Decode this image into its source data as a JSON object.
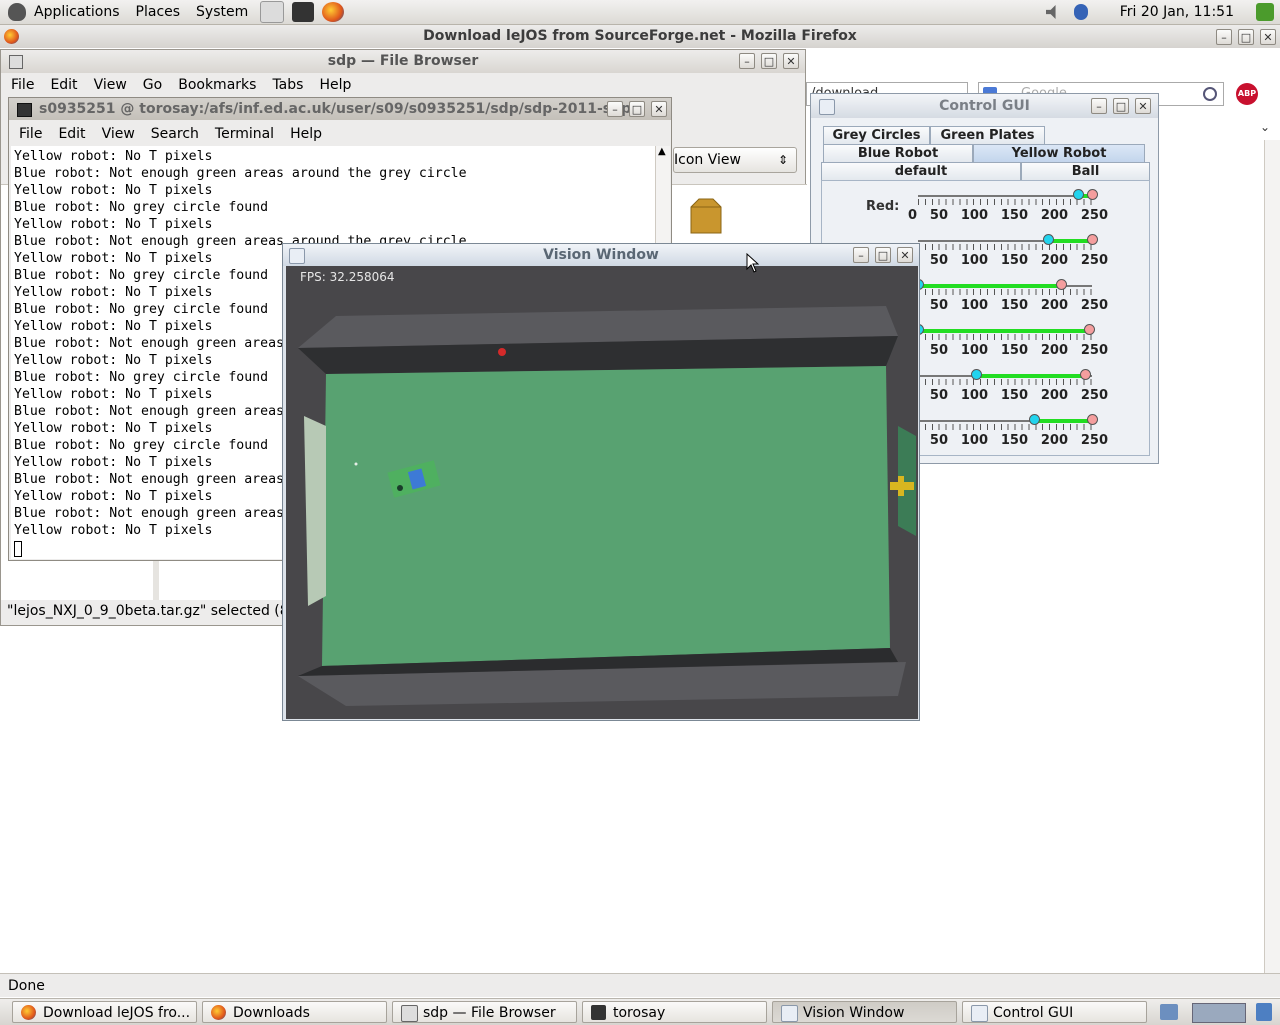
{
  "top_panel": {
    "menus": [
      "Applications",
      "Places",
      "System"
    ],
    "clock": "Fri 20 Jan, 11:51"
  },
  "firefox": {
    "window_title": "Download leJOS from SourceForge.net - Mozilla Firefox",
    "url_fragment": "/download",
    "search_placeholder": "Google",
    "status": "Done"
  },
  "file_browser": {
    "title": "sdp — File Browser",
    "menu": [
      "File",
      "Edit",
      "View",
      "Go",
      "Bookmarks",
      "Tabs",
      "Help"
    ],
    "view_mode": "Icon View",
    "status": "\"lejos_NXJ_0_9_0beta.tar.gz\" selected (8.2"
  },
  "terminal": {
    "title": "s0935251 @ torosay:/afs/inf.ed.ac.uk/user/s09/s0935251/sdp/sdp-2011-sdp",
    "menu": [
      "File",
      "Edit",
      "View",
      "Search",
      "Terminal",
      "Help"
    ],
    "lines": [
      "Yellow robot: No T pixels",
      "Blue robot: Not enough green areas around the grey circle",
      "Yellow robot: No T pixels",
      "Blue robot: No grey circle found",
      "Yellow robot: No T pixels",
      "Blue robot: Not enough green areas around the grey circle",
      "Yellow robot: No T pixels",
      "Blue robot: No grey circle found",
      "Yellow robot: No T pixels",
      "Blue robot: No grey circle found",
      "Yellow robot: No T pixels",
      "Blue robot: Not enough green areas",
      "Yellow robot: No T pixels",
      "Blue robot: No grey circle found",
      "Yellow robot: No T pixels",
      "Blue robot: Not enough green areas",
      "Yellow robot: No T pixels",
      "Blue robot: No grey circle found",
      "Yellow robot: No T pixels",
      "Blue robot: Not enough green areas",
      "Yellow robot: No T pixels",
      "Blue robot: Not enough green areas",
      "Yellow robot: No T pixels"
    ]
  },
  "control_gui": {
    "title": "Control GUI",
    "tabs_row1": [
      "Grey Circles",
      "Green Plates"
    ],
    "tabs_row2": [
      "Blue Robot",
      "Yellow Robot"
    ],
    "tabs_row3": [
      "default",
      "Ball"
    ],
    "selected_tab": "Yellow Robot",
    "tick_labels": [
      "0",
      "50",
      "100",
      "150",
      "200",
      "250"
    ],
    "sliders": [
      {
        "label": "Red:",
        "low": 235,
        "high": 255
      },
      {
        "label": "",
        "low": 190,
        "high": 255
      },
      {
        "label": "",
        "low": 0,
        "high": 210
      },
      {
        "label": "",
        "low": 0,
        "high": 250
      },
      {
        "label": "",
        "low": 85,
        "high": 245
      },
      {
        "label": "",
        "low": 170,
        "high": 255
      }
    ]
  },
  "vision_window": {
    "title": "Vision Window",
    "fps": "FPS: 32.258064"
  },
  "taskbar": {
    "tasks": [
      "Download leJOS fro...",
      "Downloads",
      "sdp — File Browser",
      "torosay",
      "Vision Window",
      "Control GUI"
    ],
    "active": "Vision Window"
  },
  "colors": {
    "pitch": "#55a06f",
    "slider_range": "#22dd22",
    "knob_low": "#22d4ee",
    "knob_high": "#f49e9e"
  }
}
